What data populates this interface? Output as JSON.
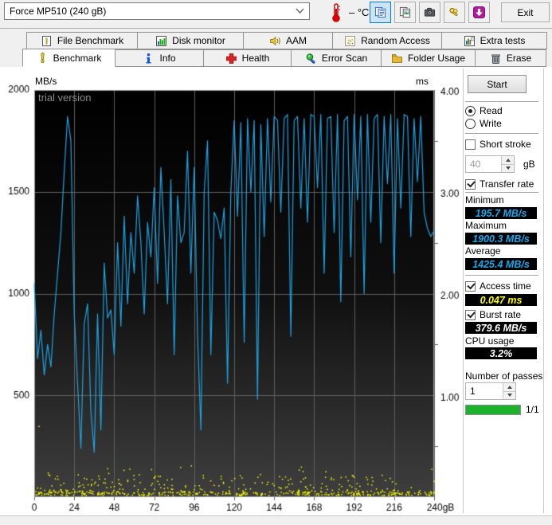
{
  "toolbar": {
    "drive_selected": "Force MP510 (240 gB)",
    "temperature": "– °C",
    "exit_label": "Exit"
  },
  "tabs_top": [
    {
      "label": "File Benchmark",
      "icon": "file-benchmark-icon"
    },
    {
      "label": "Disk monitor",
      "icon": "disk-monitor-icon"
    },
    {
      "label": "AAM",
      "icon": "speaker-icon"
    },
    {
      "label": "Random Access",
      "icon": "random-access-icon"
    },
    {
      "label": "Extra tests",
      "icon": "extra-tests-icon"
    }
  ],
  "tabs_bottom": [
    {
      "label": "Benchmark",
      "icon": "exclamation-icon",
      "active": true
    },
    {
      "label": "Info",
      "icon": "info-icon"
    },
    {
      "label": "Health",
      "icon": "health-cross-icon"
    },
    {
      "label": "Error Scan",
      "icon": "magnifier-icon"
    },
    {
      "label": "Folder Usage",
      "icon": "folder-icon"
    },
    {
      "label": "Erase",
      "icon": "trash-icon"
    }
  ],
  "controls": {
    "start": "Start",
    "read": "Read",
    "write": "Write",
    "short_stroke": "Short stroke",
    "short_stroke_value": "40",
    "short_stroke_unit": "gB",
    "transfer_rate": "Transfer rate",
    "minimum_label": "Minimum",
    "minimum_value": "195.7 MB/s",
    "maximum_label": "Maximum",
    "maximum_value": "1900.3 MB/s",
    "average_label": "Average",
    "average_value": "1425.4 MB/s",
    "access_time_label": "Access time",
    "access_time_value": "0.047 ms",
    "burst_rate_label": "Burst rate",
    "burst_rate_value": "379.6 MB/s",
    "cpu_usage_label": "CPU usage",
    "cpu_usage_value": "3.2%",
    "passes_label": "Number of passes",
    "passes_value": "1",
    "progress_text": "1/1",
    "progress_green": "#1cb22b"
  },
  "chart_data": {
    "type": "line+scatter",
    "watermark": "trial version",
    "x_axis": {
      "range": [
        0,
        240
      ],
      "tick_values": [
        0,
        24,
        48,
        72,
        96,
        120,
        144,
        168,
        192,
        216,
        240
      ],
      "tick_labels": [
        "0",
        "24",
        "48",
        "72",
        "96",
        "120",
        "144",
        "168",
        "192",
        "216",
        "240gB"
      ]
    },
    "y_left": {
      "unit": "MB/s",
      "range": [
        0,
        2000
      ],
      "tick_values": [
        2000,
        1500,
        1000,
        500
      ]
    },
    "y_right": {
      "unit": "ms",
      "range": [
        0,
        4
      ],
      "tick_values": [
        4,
        3,
        2,
        1
      ],
      "tick_labels": [
        "4.00",
        "3.00",
        "2.00",
        "1.00"
      ],
      "minor_ticks": [
        0.5,
        1.5,
        2.5,
        3.5
      ]
    },
    "grid_color": "#5f5f5f",
    "border_color": "#999999",
    "bg_gradient": [
      "#000000",
      "#101010",
      "#3f3f3f"
    ],
    "series": [
      {
        "name": "transfer_rate",
        "type": "line",
        "color": "#1fa3e3",
        "x_start": 0,
        "x_step": 2,
        "values_mbps": [
          1050,
          680,
          820,
          600,
          750,
          640,
          900,
          1100,
          1300,
          1600,
          1870,
          1750,
          900,
          560,
          240,
          850,
          950,
          420,
          220,
          900,
          330,
          1150,
          880,
          920,
          700,
          1250,
          840,
          1380,
          950,
          1300,
          1100,
          1480,
          1250,
          900,
          1350,
          1180,
          1520,
          1050,
          1620,
          1300,
          950,
          1560,
          700,
          1480,
          1250,
          1300,
          1700,
          1100,
          1620,
          800,
          330,
          1500,
          1750,
          700,
          1400,
          1360,
          1270,
          1420,
          560,
          1500,
          1850,
          1380,
          1840,
          760,
          1860,
          1500,
          1850,
          480,
          1830,
          1280,
          1860,
          1450,
          1870,
          1850,
          1400,
          1860,
          1880,
          790,
          1850,
          1870,
          1420,
          1860,
          1350,
          1880,
          1870,
          1520,
          1880,
          1100,
          1860,
          1870,
          1300,
          1880,
          960,
          1850,
          1870,
          1180,
          1880,
          1460,
          1870,
          1000,
          1880,
          1350,
          1860,
          1880,
          1250,
          1870,
          1540,
          1880,
          1100,
          1860,
          1420,
          1880,
          1870,
          1280,
          1860,
          1550,
          1870,
          1400,
          1320,
          1280,
          1310
        ]
      },
      {
        "name": "access_time",
        "type": "scatter",
        "color": "#ffff00",
        "seed": 11,
        "strip": {
          "count": 300,
          "ms_min": 0.02,
          "ms_span": 0.035
        },
        "band": {
          "count": 280,
          "ms_min": 0.055,
          "ms_span": 0.17,
          "right_thinning": 0.38
        },
        "sparse": {
          "count": 22,
          "ms_min": 0.18,
          "ms_span": 0.14
        },
        "outliers": [
          [
            2.5,
            0.7
          ],
          [
            57,
            0.28
          ],
          [
            160,
            0.3
          ]
        ]
      }
    ]
  }
}
